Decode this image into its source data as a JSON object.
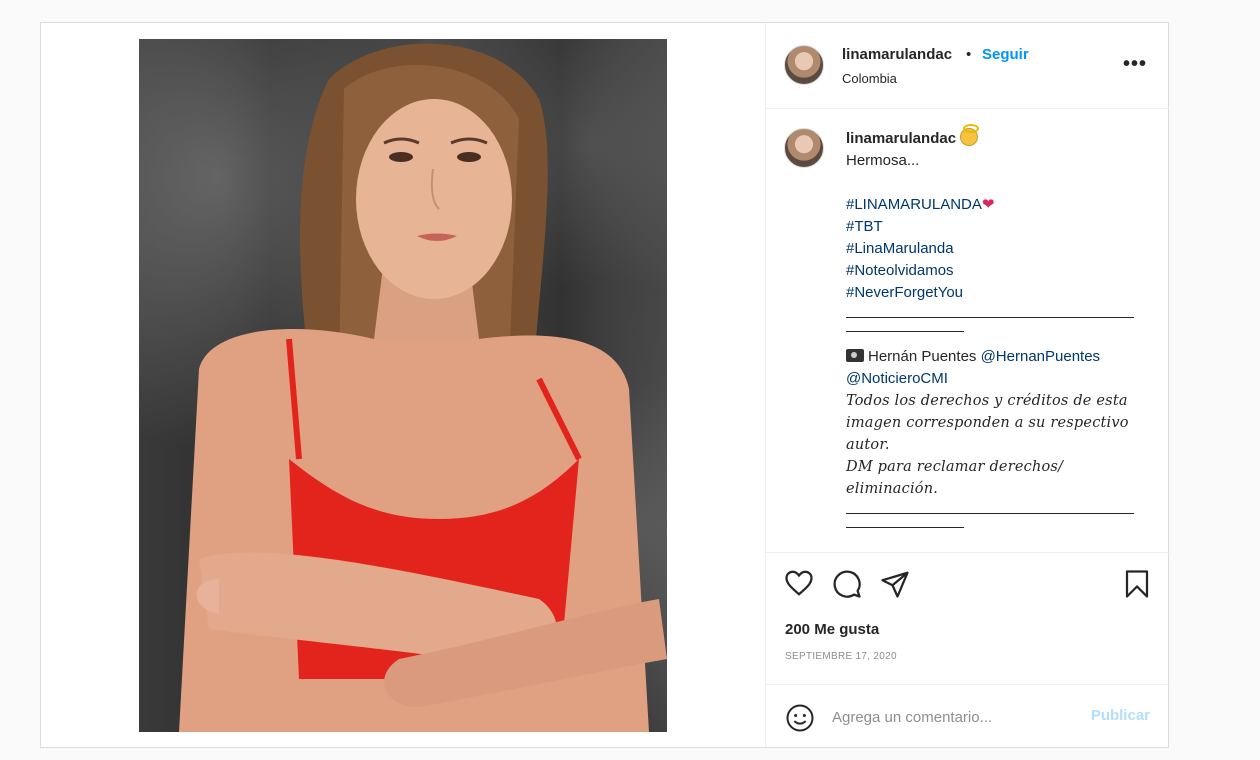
{
  "post": {
    "author": {
      "username": "linamarulandac",
      "separator": "•",
      "follow_label": "Seguir",
      "location": "Colombia",
      "more_icon": "ellipsis-icon",
      "more_label": "•••"
    },
    "caption": {
      "username": "linamarulandac",
      "text_line": "Hermosa...",
      "hashtags": [
        "#LINAMARULANDA",
        "#TBT",
        "#LinaMarulanda",
        "#Noteolvidamos",
        "#NeverForgetYou"
      ],
      "heart": "❤",
      "credit_name": "Hernán Puentes",
      "credit_mentions": [
        "@HernanPuentes",
        "@NoticieroCMI"
      ],
      "rights_text": "Todos los derechos y créditos de esta imagen corresponden a su respectivo autor.",
      "rights_text2": "DM para reclamar derechos/ eliminación."
    },
    "actions": {
      "like_icon": "heart-icon",
      "comment_icon": "comment-icon",
      "share_icon": "send-icon",
      "save_icon": "bookmark-icon"
    },
    "likes_label": "200 Me gusta",
    "date_label": "SEPTIEMBRE 17, 2020",
    "comment_box": {
      "emoji_icon": "smiley-icon",
      "placeholder": "Agrega un comentario...",
      "publish_label": "Publicar"
    }
  },
  "colors": {
    "link_blue": "#0095f6",
    "hashtag": "#00376b",
    "publish_disabled": "#b2dffc",
    "dress_red": "#e3241c"
  }
}
